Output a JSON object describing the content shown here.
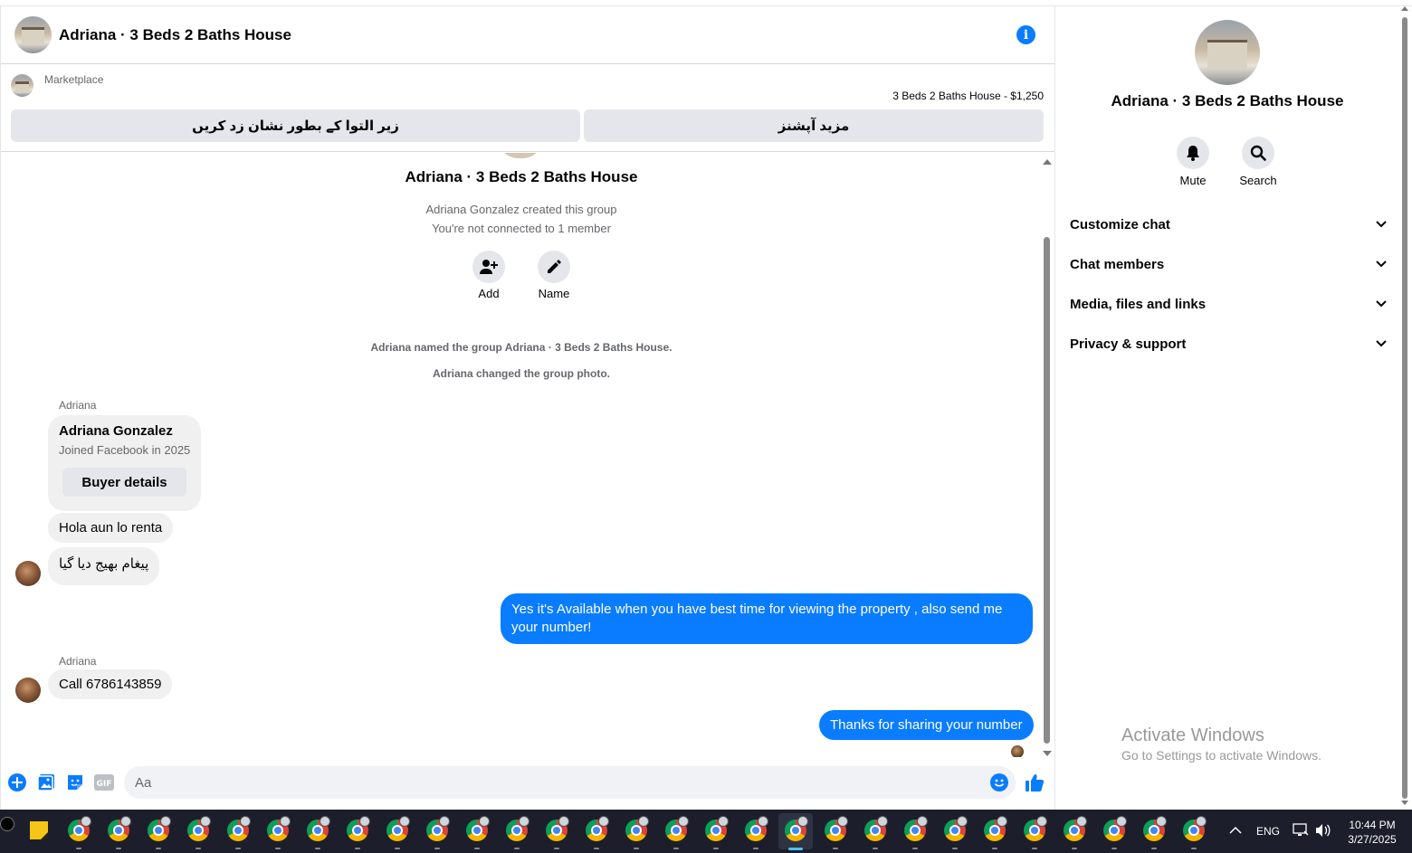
{
  "header": {
    "title": "Adriana · 3 Beds 2 Baths House",
    "info_icon": "info-icon"
  },
  "marketplace": {
    "label": "Marketplace",
    "price_line": "3 Beds 2 Baths House - $1,250",
    "mark_pending_label": "زیر التوا کے بطور نشان زد کریں",
    "more_options_label": "مزید آپشنز"
  },
  "group_intro": {
    "name": "Adriana · 3 Beds 2 Baths House",
    "created_by": "Adriana Gonzalez created this group",
    "connection": "You're not connected to 1 member",
    "add_label": "Add",
    "name_label": "Name"
  },
  "system_messages": [
    "Adriana named the group Adriana · 3 Beds 2 Baths House.",
    "Adriana changed the group photo."
  ],
  "messages": {
    "sender_1": "Adriana",
    "card_name": "Adriana Gonzalez",
    "card_sub": "Joined Facebook in 2025",
    "card_button": "Buyer details",
    "msg_1": "Hola aun lo renta",
    "msg_2": "پیغام بھیج دیا گیا",
    "msg_3": "Yes it's Available when you have best time for viewing the property , also send me your number!",
    "sender_2": "Adriana",
    "msg_4": "Call 6786143859",
    "msg_5": "Thanks for sharing your number"
  },
  "composer": {
    "placeholder": "Aa",
    "gif_label": "GIF"
  },
  "right_panel": {
    "title": "Adriana · 3 Beds 2 Baths House",
    "mute_label": "Mute",
    "search_label": "Search",
    "sections": [
      "Customize chat",
      "Chat members",
      "Media, files and links",
      "Privacy & support"
    ]
  },
  "watermark": {
    "line1": "Activate Windows",
    "line2": "Go to Settings to activate Windows."
  },
  "taskbar": {
    "language": "ENG",
    "time": "10:44 PM",
    "date": "3/27/2025"
  },
  "colors": {
    "accent": "#0a7cff",
    "bubble_in": "#f0f0f0",
    "button_gray": "#e4e6eb",
    "taskbar": "#1c1f2b"
  }
}
